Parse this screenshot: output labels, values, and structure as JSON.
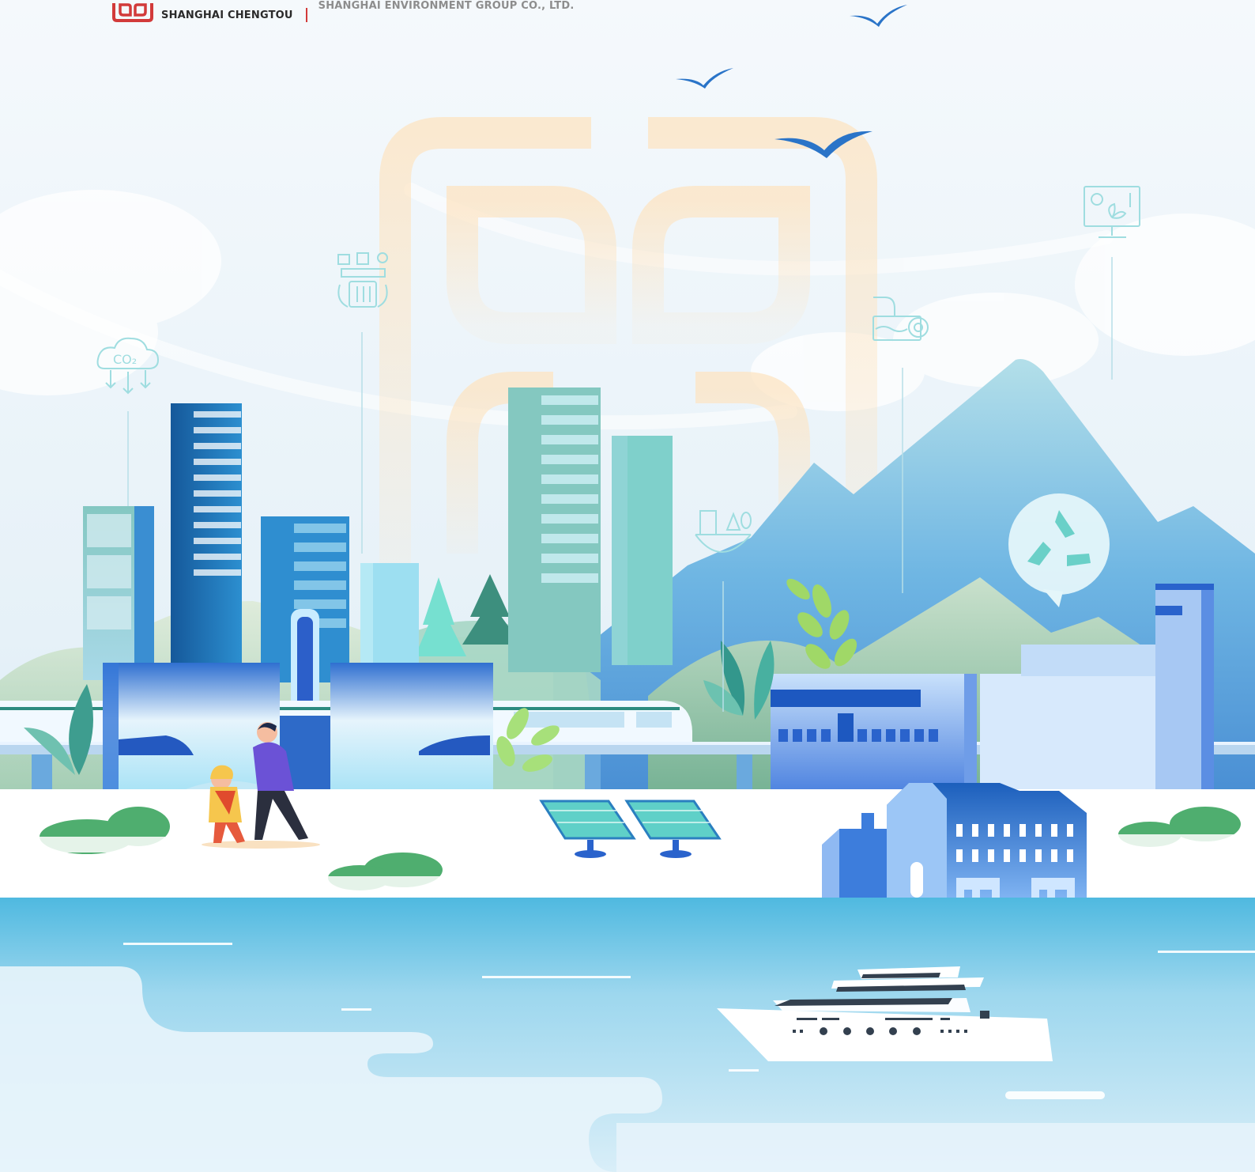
{
  "header": {
    "logo_icon": "shanghai-chengtou-logo",
    "brand_name": "SHANGHAI CHENGTOU",
    "company_name": "SHANGHAI ENVIRONMENT GROUP CO., LTD."
  },
  "illustration": {
    "icons": [
      "co2-reduction-icon",
      "recycle-bin-icon",
      "waste-water-icon",
      "monitor-plant-icon",
      "city-planet-icon",
      "recycle-symbol-icon"
    ]
  },
  "colors": {
    "brand_red": "#d23a3a",
    "sky": "#eef6fb",
    "water": "#5fc3e4",
    "mountain": "#6fb6e3",
    "building_blue": "#2a6fc4",
    "teal": "#7ccfc6"
  }
}
